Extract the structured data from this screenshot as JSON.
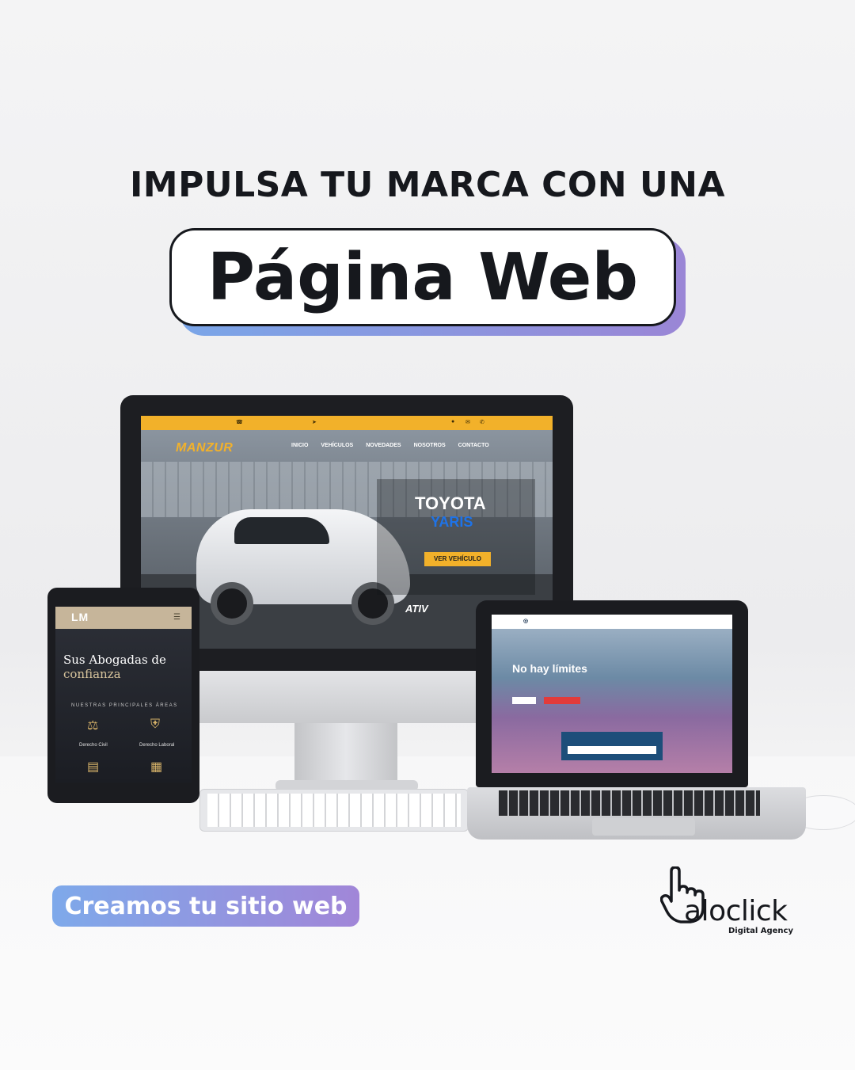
{
  "headline": "IMPULSA TU MARCA CON UNA",
  "highlight": "Página Web",
  "cta": "Creamos tu sitio web",
  "monitor_site": {
    "logo": "MANZUR",
    "nav": [
      "INICIO",
      "VEHÍCULOS",
      "NOVEDADES",
      "NOSOTROS",
      "CONTACTO"
    ],
    "brand": "TOYOTA",
    "model": "YARIS",
    "button": "VER VEHÍCULO",
    "badge": "ATIV"
  },
  "tablet_site": {
    "logo": "LM",
    "title_line1": "Sus Abogadas de",
    "title_line2": "confianza",
    "areas": "NUESTRAS PRINCIPALES ÁREAS",
    "items": [
      "Derecho Civil",
      "Derecho Laboral"
    ]
  },
  "laptop_site": {
    "title": "No hay límites"
  },
  "logo": {
    "name": "aloclick",
    "tagline": "Digital Agency"
  },
  "colors": {
    "dark": "#16181d",
    "accent_blue": "#7ea9ea",
    "accent_purple": "#a186d8",
    "yellow": "#f2b12a"
  }
}
